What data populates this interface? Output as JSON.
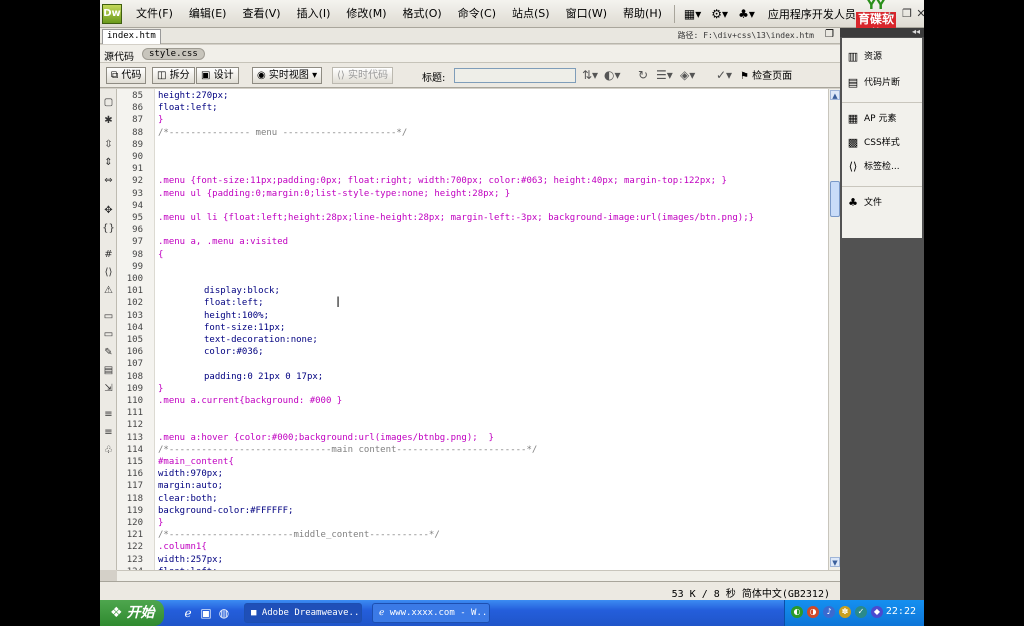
{
  "menubar": {
    "logo": "Dw",
    "items": [
      "文件(F)",
      "编辑(E)",
      "查看(V)",
      "插入(I)",
      "修改(M)",
      "格式(O)",
      "命令(C)",
      "站点(S)",
      "窗口(W)",
      "帮助(H)"
    ],
    "workspace": "应用程序开发人员",
    "brand_top": "YY",
    "brand_text": "育碟软件"
  },
  "document": {
    "tab": "index.htm",
    "path_label": "路径:",
    "path": "F:\\div+css\\13\\index.htm",
    "source_code": "源代码",
    "related_css": "style.css"
  },
  "toolbar": {
    "code": "代码",
    "split": "拆分",
    "design": "设计",
    "live_view": "实时视图",
    "live_code": "实时代码",
    "title_label": "标题:",
    "title_value": "",
    "check_page": "检查页面"
  },
  "code": {
    "lines": [
      {
        "n": "85",
        "t": "height:270px;",
        "c": "prop",
        "i": 0
      },
      {
        "n": "86",
        "t": "float:left;",
        "c": "prop",
        "i": 0
      },
      {
        "n": "87",
        "t": "}",
        "c": "sel",
        "i": 0
      },
      {
        "n": "88",
        "t": "/*--------------- menu ---------------------*/",
        "c": "cmt",
        "i": 0
      },
      {
        "n": "89",
        "t": "",
        "c": "def",
        "i": 0
      },
      {
        "n": "90",
        "t": "",
        "c": "def",
        "i": 0
      },
      {
        "n": "91",
        "t": "",
        "c": "def",
        "i": 0
      },
      {
        "n": "92",
        "t": ".menu {font-size:11px;padding:0px; float:right; width:700px; color:#063; height:40px; margin-top:122px; }",
        "c": "sel",
        "i": 0
      },
      {
        "n": "93",
        "t": ".menu ul {padding:0;margin:0;list-style-type:none; height:28px; }",
        "c": "sel",
        "i": 0
      },
      {
        "n": "94",
        "t": "",
        "c": "def",
        "i": 0
      },
      {
        "n": "95",
        "t": ".menu ul li {float:left;height:28px;line-height:28px; margin-left:-3px; background-image:url(images/btn.png);}",
        "c": "sel",
        "i": 0
      },
      {
        "n": "96",
        "t": "",
        "c": "def",
        "i": 0
      },
      {
        "n": "97",
        "t": ".menu a, .menu a:visited",
        "c": "sel",
        "i": 0
      },
      {
        "n": "98",
        "t": "{",
        "c": "sel",
        "i": 0
      },
      {
        "n": "99",
        "t": "",
        "c": "def",
        "i": 0
      },
      {
        "n": "100",
        "t": "",
        "c": "def",
        "i": 0
      },
      {
        "n": "101",
        "t": "display:block;",
        "c": "prop",
        "i": 1
      },
      {
        "n": "102",
        "t": "float:left;",
        "c": "prop",
        "i": 1
      },
      {
        "n": "103",
        "t": "height:100%;",
        "c": "prop",
        "i": 1
      },
      {
        "n": "104",
        "t": "font-size:11px;",
        "c": "prop",
        "i": 1
      },
      {
        "n": "105",
        "t": "text-decoration:none;",
        "c": "prop",
        "i": 1
      },
      {
        "n": "106",
        "t": "color:#036;",
        "c": "prop",
        "i": 1
      },
      {
        "n": "107",
        "t": "",
        "c": "def",
        "i": 0
      },
      {
        "n": "108",
        "t": "padding:0 21px 0 17px;",
        "c": "prop",
        "i": 1
      },
      {
        "n": "109",
        "t": "}",
        "c": "sel",
        "i": 0
      },
      {
        "n": "110",
        "t": ".menu a.current{background: #000 }",
        "c": "sel",
        "i": 0
      },
      {
        "n": "111",
        "t": "",
        "c": "def",
        "i": 0
      },
      {
        "n": "112",
        "t": "",
        "c": "def",
        "i": 0
      },
      {
        "n": "113",
        "t": ".menu a:hover {color:#000;background:url(images/btnbg.png);  }",
        "c": "sel",
        "i": 0
      },
      {
        "n": "114",
        "t": "/*------------------------------main content------------------------*/",
        "c": "cmt",
        "i": 0
      },
      {
        "n": "115",
        "t": "#main_content{",
        "c": "sel",
        "i": 0
      },
      {
        "n": "116",
        "t": "width:970px;",
        "c": "prop",
        "i": 0
      },
      {
        "n": "117",
        "t": "margin:auto;",
        "c": "prop",
        "i": 0
      },
      {
        "n": "118",
        "t": "clear:both;",
        "c": "prop",
        "i": 0
      },
      {
        "n": "119",
        "t": "background-color:#FFFFFF;",
        "c": "prop",
        "i": 0
      },
      {
        "n": "120",
        "t": "}",
        "c": "sel",
        "i": 0
      },
      {
        "n": "121",
        "t": "/*-----------------------middle_content-----------*/",
        "c": "cmt",
        "i": 0
      },
      {
        "n": "122",
        "t": ".column1{",
        "c": "sel",
        "i": 0
      },
      {
        "n": "123",
        "t": "width:257px;",
        "c": "prop",
        "i": 0
      },
      {
        "n": "124",
        "t": "float:left;",
        "c": "prop",
        "i": 0
      }
    ]
  },
  "status": {
    "text": "53 K / 8 秒  简体中文(GB2312)"
  },
  "panel": {
    "items": [
      {
        "label": "资源",
        "icon": "assets-icon"
      },
      {
        "label": "代码片断",
        "icon": "snippets-icon"
      },
      {
        "label": "AP 元素",
        "icon": "ap-elements-icon"
      },
      {
        "label": "CSS样式",
        "icon": "css-styles-icon"
      },
      {
        "label": "标签检...",
        "icon": "tag-inspector-icon"
      },
      {
        "label": "文件",
        "icon": "files-icon"
      }
    ]
  },
  "taskbar": {
    "start": "开始",
    "tasks": [
      "Adobe Dreamweave...",
      "www.xxxx.com - W..."
    ],
    "clock": "22:22"
  },
  "colors": {
    "selector": "#c000c0",
    "property": "#000080",
    "comment": "#808080",
    "taskbar": "#245edb",
    "start": "#2f8a2f"
  }
}
